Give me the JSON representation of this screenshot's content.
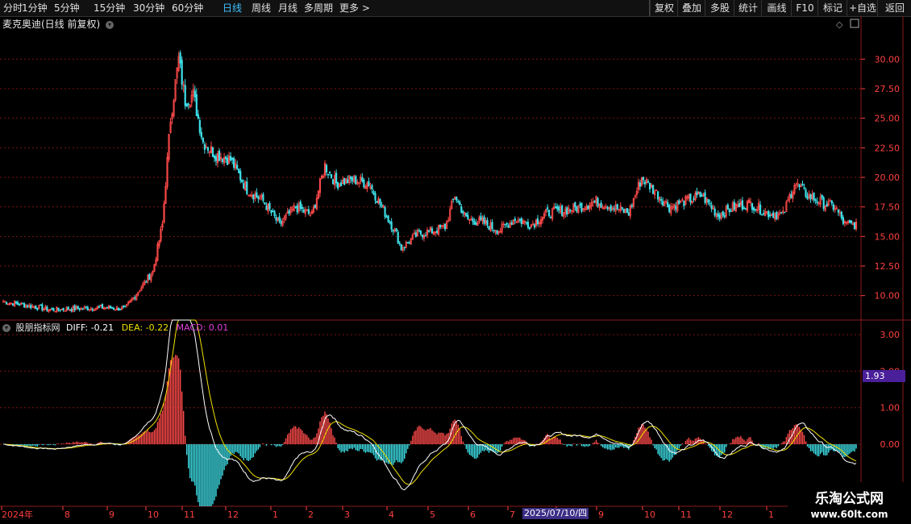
{
  "toolbar": {
    "timeframes": [
      "分时",
      "1分钟",
      "5分钟",
      "15分钟",
      "30分钟",
      "60分钟",
      "日线",
      "周线",
      "月线",
      "多周期",
      "更多 >"
    ],
    "active": "日线",
    "buttons": [
      "复权",
      "叠加",
      "多股",
      "统计",
      "画线",
      "F10",
      "标记",
      "+自选",
      "返回"
    ]
  },
  "price_panel": {
    "title": "麦克奥迪(日线 前复权)"
  },
  "indicator_panel": {
    "name": "股朋指标网",
    "diff_label": "DIFF: -0.21",
    "dea_label": "DEA: -0.22",
    "macd_label": "MACD: 0.01",
    "value_tag": "1.93"
  },
  "date_tag": "2025/07/10/四",
  "watermark": {
    "line1": "乐淘公式网",
    "line2": "www.60lt.com"
  },
  "colors": {
    "up": "#ff4a4a",
    "down": "#3ee0e8",
    "diff": "#ffffff",
    "dea": "#f0e000",
    "macd_label": "#e040e0",
    "grid": "#7a1515",
    "axis_text": "#ff4040"
  },
  "chart_data": [
    {
      "type": "candlestick",
      "title": "麦克奥迪(日线 前复权)",
      "y_ticks": [
        10.0,
        12.5,
        15.0,
        17.5,
        20.0,
        22.5,
        25.0,
        27.5,
        30.0
      ],
      "ylim": [
        8.0,
        33.5
      ],
      "x_ticks": [
        "2024年",
        "8",
        "9",
        "10",
        "11",
        "12",
        "1",
        "2",
        "3",
        "4",
        "5",
        "6",
        "7",
        "8",
        "9",
        "10",
        "11",
        "12",
        "1"
      ],
      "close_anchors": [
        [
          0,
          9.5
        ],
        [
          30,
          8.8
        ],
        [
          60,
          9.0
        ],
        [
          75,
          8.9
        ],
        [
          92,
          12.0
        ],
        [
          98,
          16.0
        ],
        [
          103,
          25.0
        ],
        [
          108,
          30.0
        ],
        [
          112,
          26.5
        ],
        [
          117,
          27.0
        ],
        [
          123,
          23.0
        ],
        [
          130,
          22.0
        ],
        [
          140,
          21.5
        ],
        [
          150,
          19.0
        ],
        [
          160,
          18.0
        ],
        [
          170,
          16.0
        ],
        [
          180,
          17.5
        ],
        [
          190,
          16.8
        ],
        [
          198,
          21.0
        ],
        [
          205,
          19.5
        ],
        [
          215,
          19.8
        ],
        [
          225,
          19.5
        ],
        [
          235,
          17.0
        ],
        [
          242,
          15.2
        ],
        [
          245,
          14.0
        ],
        [
          255,
          15.2
        ],
        [
          265,
          15.5
        ],
        [
          272,
          15.8
        ],
        [
          278,
          18.5
        ],
        [
          285,
          16.5
        ],
        [
          295,
          16.2
        ],
        [
          305,
          15.5
        ],
        [
          315,
          16.5
        ],
        [
          325,
          16.0
        ],
        [
          335,
          17.0
        ],
        [
          345,
          17.2
        ],
        [
          355,
          17.5
        ],
        [
          365,
          18.0
        ],
        [
          375,
          17.5
        ],
        [
          385,
          17.0
        ],
        [
          393,
          20.0
        ],
        [
          400,
          19.0
        ],
        [
          410,
          17.5
        ],
        [
          420,
          18.0
        ],
        [
          430,
          18.5
        ],
        [
          440,
          16.8
        ],
        [
          450,
          17.5
        ],
        [
          460,
          17.8
        ],
        [
          470,
          17.0
        ],
        [
          480,
          16.8
        ],
        [
          487,
          19.5
        ],
        [
          495,
          18.5
        ],
        [
          505,
          17.8
        ],
        [
          512,
          17.5
        ],
        [
          518,
          16.0
        ],
        [
          525,
          16.0
        ]
      ],
      "note": ""
    },
    {
      "type": "macd",
      "series": [
        {
          "name": "DIFF",
          "last": -0.21
        },
        {
          "name": "DEA",
          "last": -0.22
        },
        {
          "name": "MACD",
          "last": 0.01
        }
      ],
      "y_ticks": [
        0.0,
        1.0,
        2.0,
        3.0
      ],
      "ylim": [
        -1.7,
        3.4
      ]
    }
  ]
}
